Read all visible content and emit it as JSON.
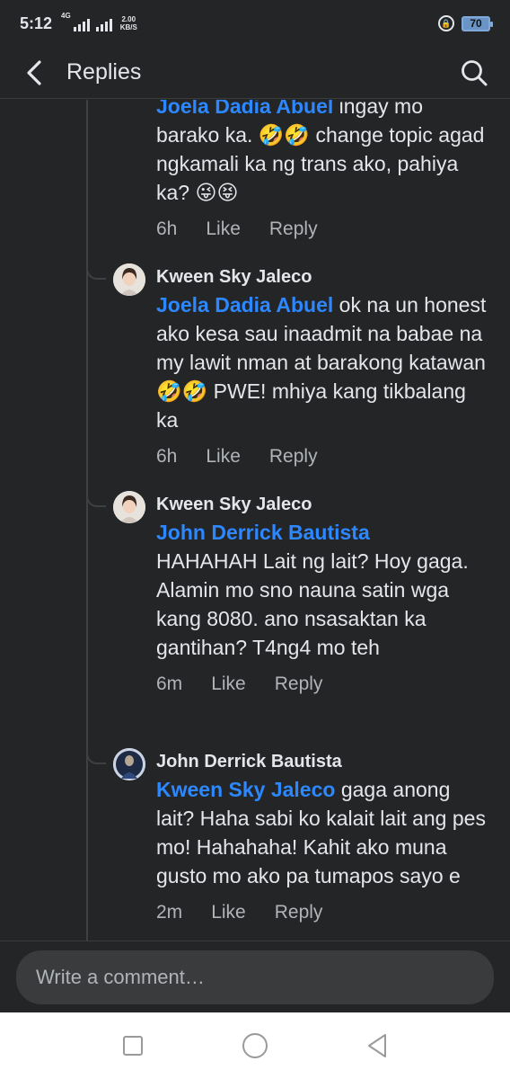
{
  "status": {
    "time": "5:12",
    "network": "4G",
    "speed_value": "2.00",
    "speed_unit": "KB/S",
    "battery": "70"
  },
  "header": {
    "title": "Replies"
  },
  "comments": [
    {
      "author": "",
      "mention": "Joela Dadia Abuel",
      "text": " ingay mo barako ka. 🤣🤣 change topic agad ngkamali ka ng trans ako, pahiya ka? 😜😝",
      "time": "6h",
      "like": "Like",
      "reply": "Reply"
    },
    {
      "author": "Kween Sky Jaleco",
      "mention": "Joela Dadia Abuel",
      "text": " ok na un honest ako kesa sau inaadmit na babae na my lawit nman at barakong katawan 🤣🤣 PWE! mhiya kang tikbalang ka",
      "time": "6h",
      "like": "Like",
      "reply": "Reply"
    },
    {
      "author": "Kween Sky Jaleco",
      "mention": "John Derrick Bautista",
      "text": "HAHAHAH Lait ng lait? Hoy gaga. Alamin mo sno nauna satin wga kang 8080. ano nsasaktan ka gantihan? T4ng4 mo teh",
      "time": "6m",
      "like": "Like",
      "reply": "Reply"
    },
    {
      "author": "John Derrick Bautista",
      "mention": "Kween Sky Jaleco",
      "text": " gaga anong lait? Haha sabi ko kalait lait ang pes mo! Hahahaha! Kahit ako muna gusto mo ako pa tumapos sayo e",
      "time": "2m",
      "like": "Like",
      "reply": "Reply"
    }
  ],
  "composer": {
    "placeholder": "Write a comment…"
  },
  "colors": {
    "background": "#242526",
    "mention": "#2d88ff",
    "secondary_text": "#b0b3b8"
  }
}
